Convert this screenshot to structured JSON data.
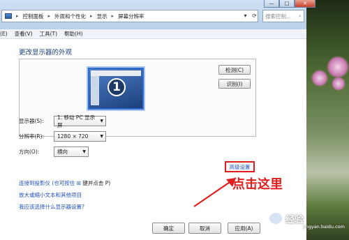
{
  "breadcrumb": [
    "控制面板",
    "外观和个性化",
    "显示",
    "屏幕分辨率"
  ],
  "search": {
    "placeholder": "搜索控制...",
    "icon": "search-icon"
  },
  "window_buttons": {
    "minimize": "—",
    "maximize": "□",
    "close": "✕"
  },
  "menu": [
    "(E)",
    "查看(V)",
    "工具(T)",
    "帮助(H)"
  ],
  "page_title": "更改显示器的外观",
  "preview": {
    "monitor_number": "1",
    "detect_label": "检测(C)",
    "identify_label": "识别(I)"
  },
  "settings": [
    {
      "label": "显示器(S):",
      "value": "1. 移动 PC 显示屏"
    },
    {
      "label": "分辨率(R):",
      "value": "1280 × 720"
    },
    {
      "label": "方向(O):",
      "value": "横向"
    }
  ],
  "advanced_link": "高级设置",
  "links": [
    "连接到投影仪 (也可按住",
    "键并点击 P)",
    "放大或缩小文本和其他项目",
    "我应该选择什么显示器设置?"
  ],
  "callout_text": "点击这里",
  "bottom_buttons": [
    "确定",
    "取消",
    "应用(A)"
  ],
  "watermark": {
    "text": "经验",
    "sub": "jingyan.baidu.com"
  },
  "colors": {
    "accent": "#e11d1d",
    "link": "#1f4fc2",
    "title": "#1c3f7a"
  }
}
